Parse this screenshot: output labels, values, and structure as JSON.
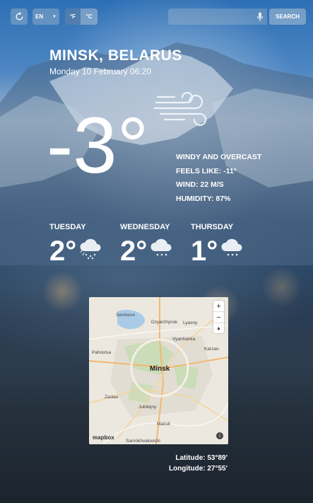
{
  "controls": {
    "language": "EN",
    "unit_f": "°F",
    "unit_c": "°C",
    "search_placeholder": "",
    "search_label": "SEARCH"
  },
  "location": {
    "city": "MINSK, BELARUS",
    "date": "Monday 10 February 06:20"
  },
  "current": {
    "temperature": "-3°",
    "condition": "WINDY AND OVERCAST",
    "feels_like": "FEELS LIKE: -11°",
    "wind": "WIND: 22 M/S",
    "humidity": "HUMIDITY: 87%",
    "icon": "wind-icon"
  },
  "forecast": [
    {
      "day": "TUESDAY",
      "temp": "2°",
      "icon": "cloud-rain-icon"
    },
    {
      "day": "WEDNESDAY",
      "temp": "2°",
      "icon": "cloud-snow-icon"
    },
    {
      "day": "THURSDAY",
      "temp": "1°",
      "icon": "cloud-snow-icon"
    }
  ],
  "map": {
    "center_label": "Minsk",
    "labels": [
      "Semkovo",
      "Dzyarzhynsk",
      "Lyasny",
      "Vyanhanka",
      "Karzan",
      "Pahostsa",
      "Zaslau",
      "Jubilejny",
      "Mačuli",
      "Samokhvalovichi"
    ],
    "attribution": "mapbox",
    "zoom_in": "+",
    "zoom_out": "−",
    "compass": "▲",
    "info": "i"
  },
  "coordinates": {
    "latitude": "Latitude: 53°89'",
    "longitude": "Longitude: 27°55'"
  },
  "colors": {
    "accent": "#ffffff",
    "control_bg": "#b8c4d0"
  }
}
